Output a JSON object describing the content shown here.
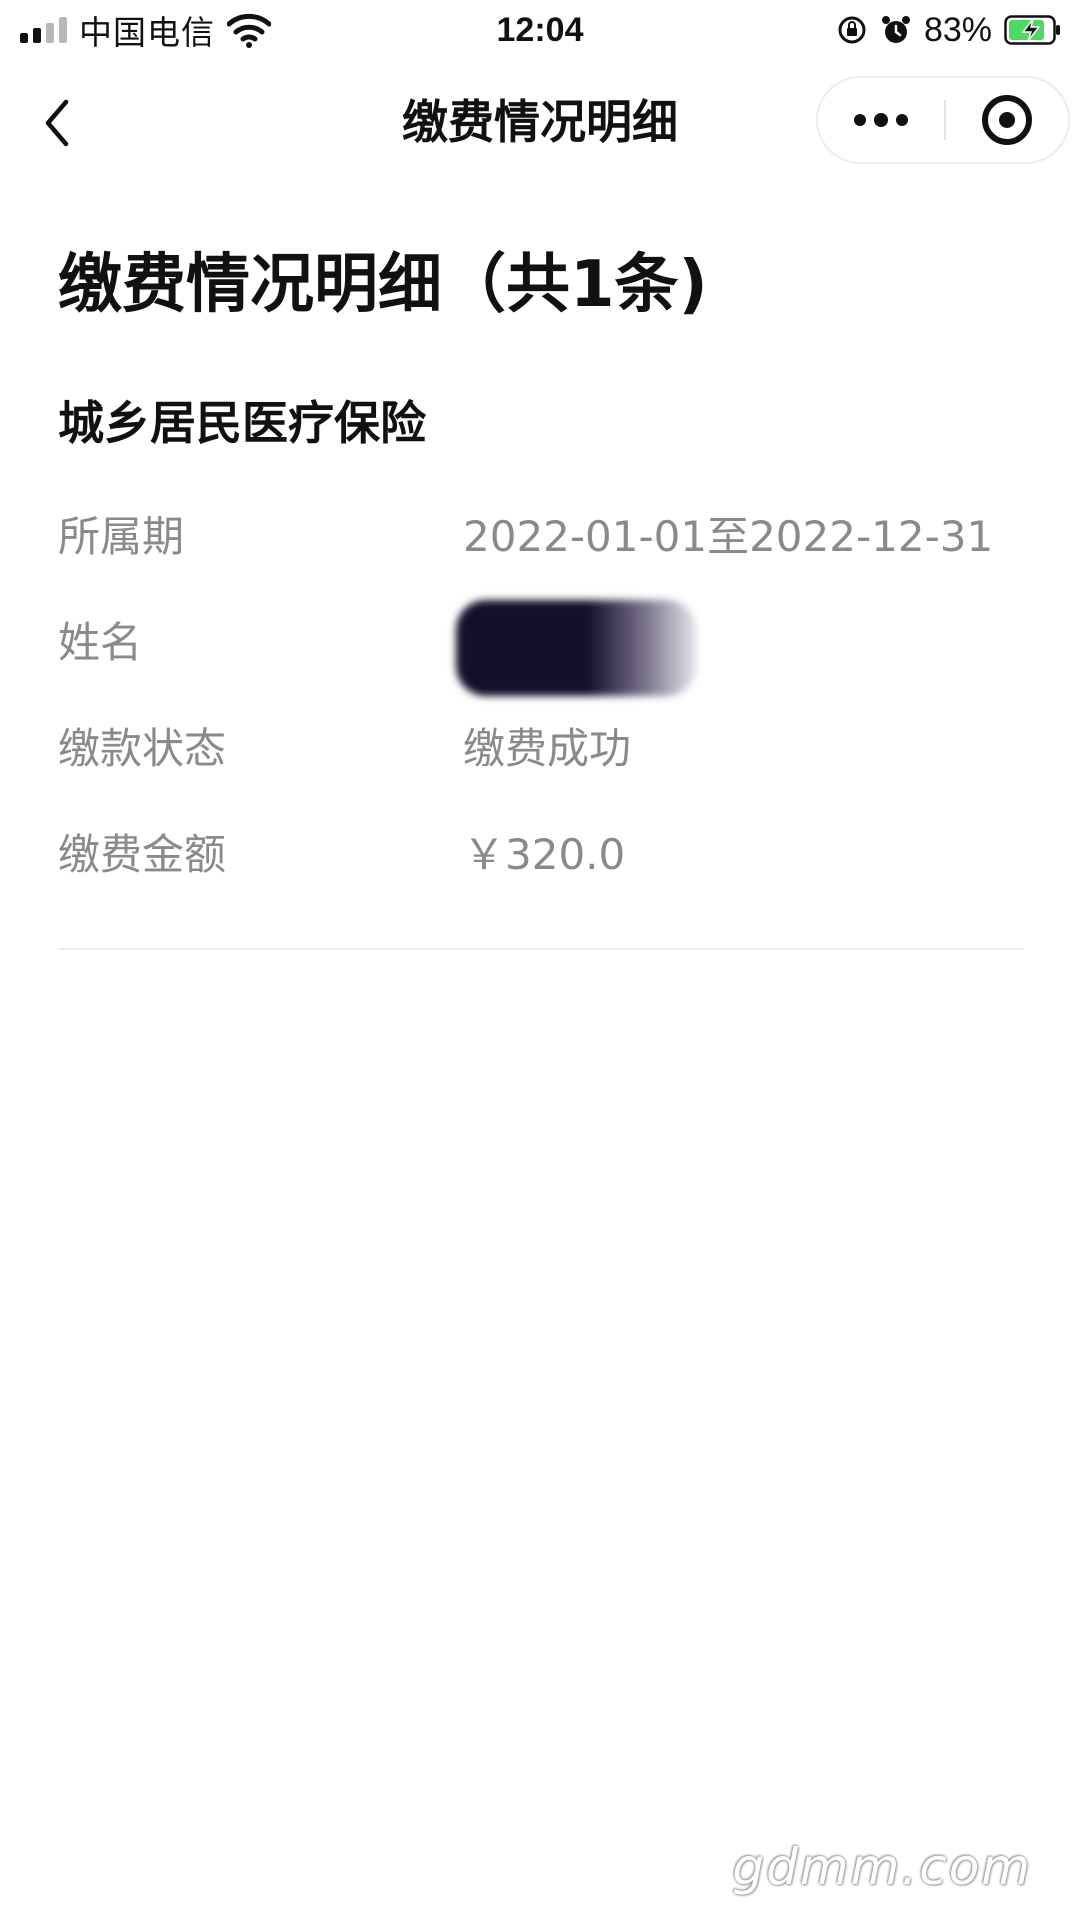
{
  "status_bar": {
    "carrier": "中国电信",
    "time": "12:04",
    "battery_percent": "83%",
    "icons": [
      "signal-icon",
      "wifi-icon",
      "rotation-lock-icon",
      "alarm-icon",
      "battery-charging-icon"
    ]
  },
  "nav": {
    "back_icon": "chevron-left-icon",
    "title": "缴费情况明细",
    "more_icon": "more-dots-icon",
    "close_icon": "target-circle-icon"
  },
  "content": {
    "heading": "缴费情况明细（共1条)",
    "record": {
      "type": "城乡居民医疗保险",
      "rows": [
        {
          "label": "所属期",
          "value": "2022-01-01至2022-12-31"
        },
        {
          "label": "姓名",
          "value": ""
        },
        {
          "label": "缴款状态",
          "value": "缴费成功"
        },
        {
          "label": "缴费金额",
          "value": "￥320.0"
        }
      ]
    }
  },
  "watermark": "gdmm.com",
  "colors": {
    "primary_text": "#111111",
    "secondary_text": "#8a8a8a",
    "divider": "#ececec",
    "battery_green": "#4cd964"
  }
}
